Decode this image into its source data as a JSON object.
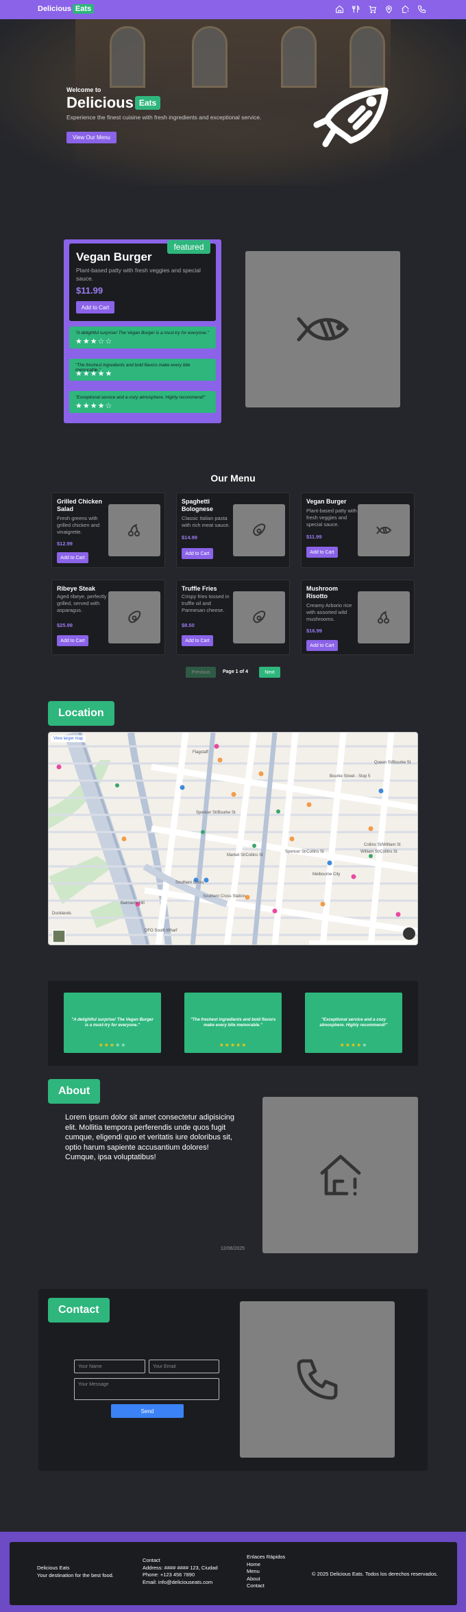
{
  "header": {
    "brand": "Delicious",
    "brand_pill": "Eats",
    "nav_icons": [
      "home-icon",
      "utensils-icon",
      "cart-icon",
      "location-icon",
      "home-alert-icon",
      "phone-icon"
    ]
  },
  "hero": {
    "welcome": "Welcome to",
    "title": "Delicious",
    "title_pill": "Eats",
    "subtitle": "Experience the finest cuisine with fresh ingredients and exceptional service.",
    "cta": "View Our Menu"
  },
  "featured": {
    "badge": "featured",
    "name": "Vegan Burger",
    "description": "Plant-based patty with fresh veggies and special sauce.",
    "price": "$11.99",
    "add": "Add to Cart",
    "reviews": [
      {
        "text": "\"A delightful surprise! The Vegan Burger is a must-try for everyone.\"",
        "stars": "★★★☆☆",
        "rating": 3
      },
      {
        "text": "\"The freshest ingredients and bold flavors make every bite memorable.\"",
        "stars": "★★★★★",
        "rating": 5
      },
      {
        "text": "\"Exceptional service and a cozy atmosphere. Highly recommend!\"",
        "stars": "★★★★☆",
        "rating": 4
      }
    ]
  },
  "menu": {
    "title": "Our Menu",
    "items": [
      {
        "name": "Grilled Chicken Salad",
        "desc": "Fresh greens with grilled chicken and vinaigrette.",
        "price": "$12.99",
        "add": "Add to Cart",
        "icon": "cherry-icon"
      },
      {
        "name": "Spaghetti Bolognese",
        "desc": "Classic Italian pasta with rich meat sauce.",
        "price": "$14.99",
        "add": "Add to Cart",
        "icon": "avocado-icon"
      },
      {
        "name": "Vegan Burger",
        "desc": "Plant-based patty with fresh veggies and special sauce.",
        "price": "$11.99",
        "add": "Add to Cart",
        "icon": "fish-icon"
      },
      {
        "name": "Ribeye Steak",
        "desc": "Aged ribeye, perfectly grilled, served with asparagus.",
        "price": "$25.99",
        "add": "Add to Cart",
        "icon": "avocado-icon"
      },
      {
        "name": "Truffle Fries",
        "desc": "Crispy fries tossed in truffle oil and Parmesan cheese.",
        "price": "$8.50",
        "add": "Add to Cart",
        "icon": "avocado-icon"
      },
      {
        "name": "Mushroom Risotto",
        "desc": "Creamy Arborio rice with assorted wild mushrooms.",
        "price": "$16.99",
        "add": "Add to Cart",
        "icon": "cherry-icon"
      }
    ],
    "pager": {
      "prev": "Previous",
      "info": "Page 1 of 4",
      "next": "Next"
    }
  },
  "location": {
    "title": "Location",
    "map_link": "View larger map",
    "map_labels": [
      "Spencer St/Bourke St",
      "Collins St/William St",
      "Southern Cross",
      "Southern Cross Station",
      "Flagstaff",
      "Docklands",
      "Bourke Street - Stop 5",
      "Queen St/Bourke St",
      "William St/Collins St",
      "Spencer St/Collins St",
      "DFO South Wharf",
      "Market St/Collins St",
      "Batman's Hill",
      "Melbourne City"
    ]
  },
  "testimonials": [
    {
      "text": "\"A delightful surprise! The Vegan Burger is a must-try for everyone.\"",
      "on": "★★★",
      "off": "★★",
      "rating": 3
    },
    {
      "text": "\"The freshest ingredients and bold flavors make every bite memorable.\"",
      "on": "★★★★★",
      "off": "",
      "rating": 5
    },
    {
      "text": "\"Exceptional service and a cozy atmosphere. Highly recommend!\"",
      "on": "★★★★",
      "off": "★",
      "rating": 4
    }
  ],
  "about": {
    "title": "About",
    "text": "Lorem ipsum dolor sit amet consectetur adipisicing elit. Mollitia tempora perferendis unde quos fugit cumque, eligendi quo et veritatis iure doloribus sit, optio harum sapiente accusantium dolores! Cumque, ipsa voluptatibus!",
    "date": "12/06/2025"
  },
  "contact": {
    "title": "Contact",
    "name_ph": "Your Name",
    "email_ph": "Your Email",
    "msg_ph": "Your Message",
    "send": "Send"
  },
  "footer": {
    "brand": "Delicious Eats",
    "tagline": "Your destination for the best food.",
    "contact_title": "Contact",
    "address": "Address: #### #### 123, Ciudad",
    "phone": "Phone: +123 456 7890",
    "email": "Email: info@deliciouseats.com",
    "links_title": "Enlaces Rápidos",
    "links": [
      "Home",
      "Menu",
      "About",
      "Contact"
    ],
    "copyright": "© 2025 Delicious Eats. Todos los derechos reservados."
  },
  "colors": {
    "accent": "#8a63e8",
    "green": "#2eb67d",
    "bg": "#25262b",
    "card": "#1b1c20",
    "send": "#3b82f6"
  }
}
